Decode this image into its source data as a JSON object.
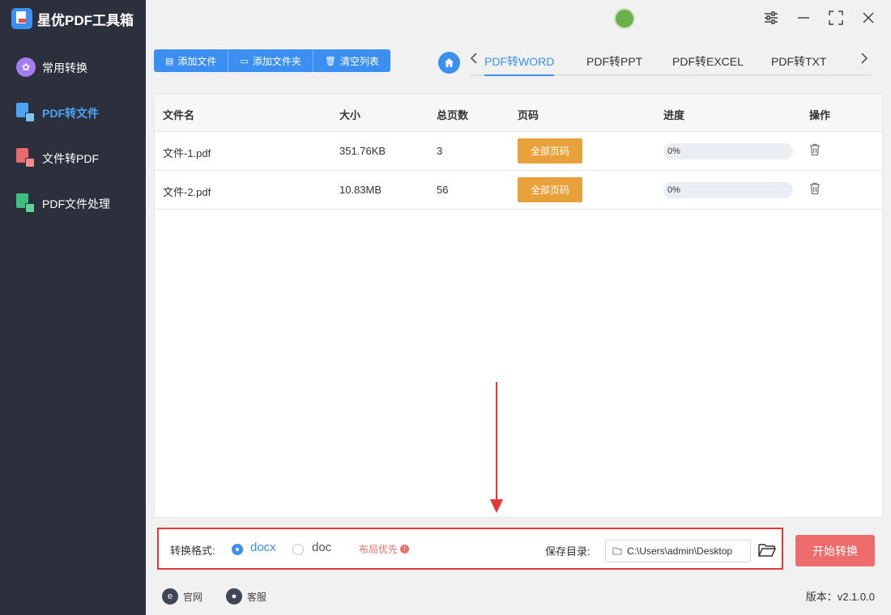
{
  "app": {
    "title": "星优PDF工具箱"
  },
  "sidebar": {
    "items": [
      {
        "label": "常用转换",
        "icon": "grid-icon",
        "active": false
      },
      {
        "label": "PDF转文件",
        "icon": "pdf-to-file-icon",
        "active": true
      },
      {
        "label": "文件转PDF",
        "icon": "file-to-pdf-icon",
        "active": false
      },
      {
        "label": "PDF文件处理",
        "icon": "pdf-process-icon",
        "active": false
      }
    ]
  },
  "toolbar": {
    "add_file": "添加文件",
    "add_folder": "添加文件夹",
    "clear_list": "清空列表"
  },
  "tabs": {
    "items": [
      "PDF转WORD",
      "PDF转PPT",
      "PDF转EXCEL",
      "PDF转TXT"
    ],
    "active": "PDF转WORD"
  },
  "table": {
    "headers": [
      "文件名",
      "大小",
      "总页数",
      "页码",
      "进度",
      "操作"
    ],
    "rows": [
      {
        "name": "文件-1.pdf",
        "size": "351.76KB",
        "pages": "3",
        "page_btn": "全部页码",
        "progress": "0%"
      },
      {
        "name": "文件-2.pdf",
        "size": "10.83MB",
        "pages": "56",
        "page_btn": "全部页码",
        "progress": "0%"
      }
    ]
  },
  "options": {
    "format_label": "转换格式:",
    "formats": [
      "docx",
      "doc"
    ],
    "selected_format": "docx",
    "layout_hint": "布局优先",
    "save_label": "保存目录:",
    "save_path": "C:\\Users\\admin\\Desktop"
  },
  "start_button": "开始转换",
  "status_bar": {
    "website": "官网",
    "support": "客服",
    "version": "版本：v2.1.0.0"
  },
  "colors": {
    "accent": "#3a8ff0",
    "sidebar_bg": "#2c303c",
    "page_button": "#e9a23b",
    "start_button": "#ef6c6c",
    "annotation": "#e53935"
  }
}
